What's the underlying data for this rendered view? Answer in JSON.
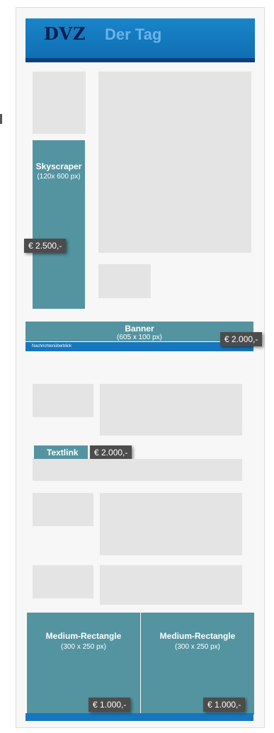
{
  "header": {
    "logo_brand": "DVZ",
    "logo_product": "Der Tag"
  },
  "skyscraper": {
    "title": "Skyscraper",
    "size": "(120x 600 px)",
    "price": "€ 2.500,-"
  },
  "banner": {
    "title": "Banner",
    "size": "(605 x 100 px)",
    "price": "€ 2.000,-",
    "subheading": "Nachrichtenüberblick"
  },
  "textlink": {
    "title": "Textlink",
    "price": "€ 2.000,-"
  },
  "medium_rectangles": [
    {
      "title": "Medium-Rectangle",
      "size": "(300 x 250 px)",
      "price": "€ 1.000,-"
    },
    {
      "title": "Medium-Rectangle",
      "size": "(300 x 250 px)",
      "price": "€ 1.000,-"
    }
  ],
  "colors": {
    "ad_teal": "#5494a1",
    "header_blue": "#1677bf",
    "placeholder_gray": "#e4e4e4",
    "price_tag": "#4c4c4c"
  }
}
